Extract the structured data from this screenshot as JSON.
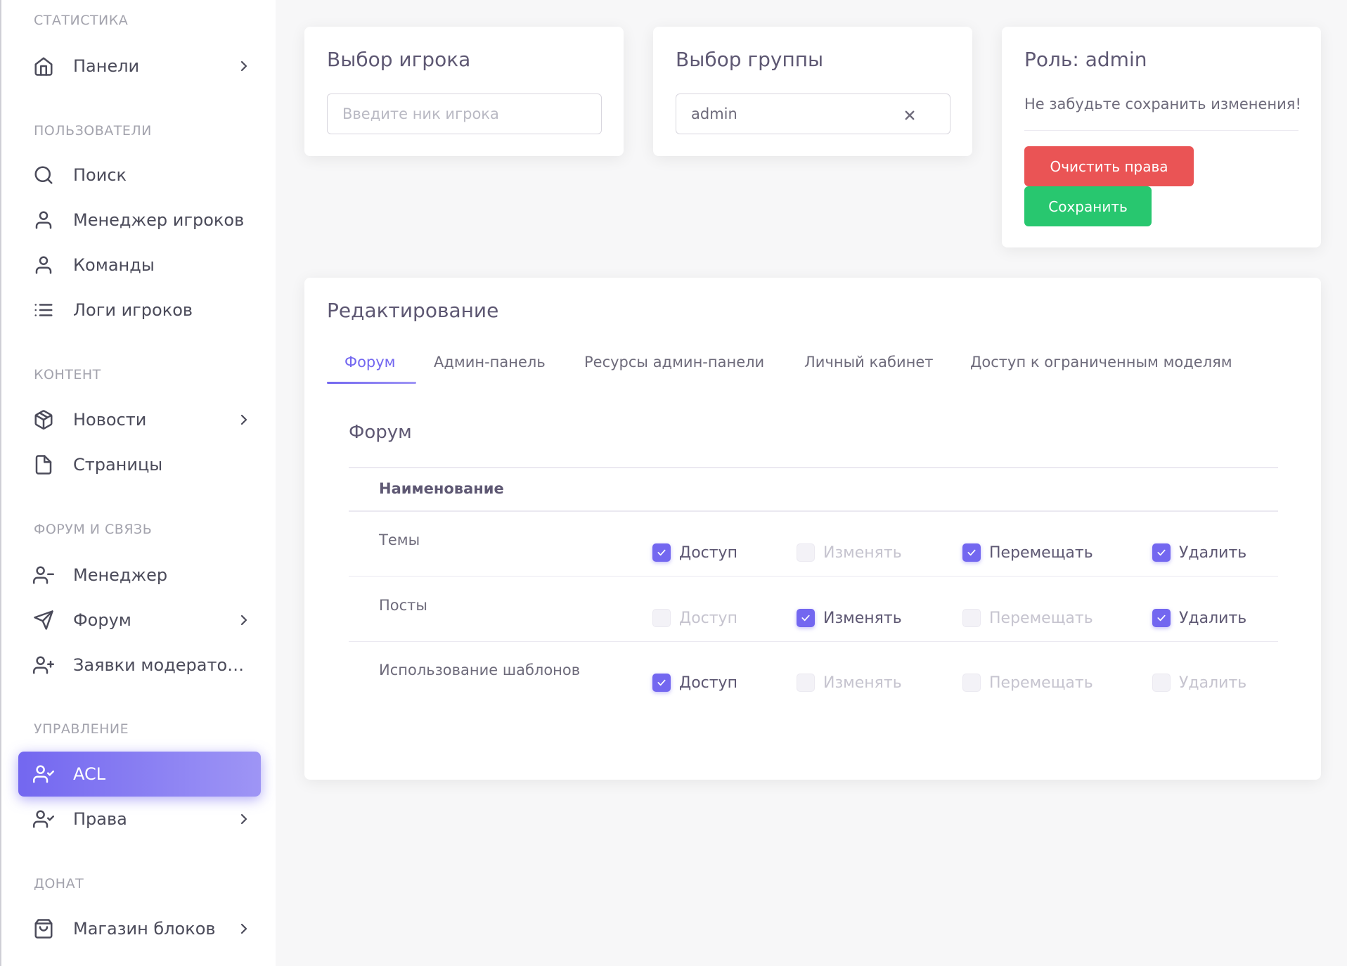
{
  "sidebar": {
    "sections": [
      {
        "header": "СТАТИСТИКА"
      },
      {
        "header": "ПОЛЬЗОВАТЕЛИ"
      },
      {
        "header": "КОНТЕНТ"
      },
      {
        "header": "ФОРУМ И СВЯЗЬ"
      },
      {
        "header": "УПРАВЛЕНИЕ"
      },
      {
        "header": "ДОНАТ"
      }
    ],
    "items": [
      {
        "label": "Панели",
        "icon": "home-icon"
      },
      {
        "label": "Поиск",
        "icon": "search-icon"
      },
      {
        "label": "Менеджер игроков",
        "icon": "user-icon"
      },
      {
        "label": "Команды",
        "icon": "user-icon"
      },
      {
        "label": "Логи игроков",
        "icon": "list-icon"
      },
      {
        "label": "Новости",
        "icon": "package-icon"
      },
      {
        "label": "Страницы",
        "icon": "file-icon"
      },
      {
        "label": "Менеджер",
        "icon": "user-minus-icon"
      },
      {
        "label": "Форум",
        "icon": "send-icon"
      },
      {
        "label": "Заявки модераторов",
        "icon": "user-plus-icon"
      },
      {
        "label": "ACL",
        "icon": "user-check-icon"
      },
      {
        "label": "Права",
        "icon": "user-check-icon"
      },
      {
        "label": "Магазин блоков",
        "icon": "shopping-bag-icon"
      }
    ]
  },
  "player_select": {
    "title": "Выбор игрока",
    "placeholder": "Введите ник игрока"
  },
  "group_select": {
    "title": "Выбор группы",
    "value": "admin"
  },
  "role_card": {
    "title": "Роль: admin",
    "note": "Не забудьте сохранить изменения!",
    "clear_label": "Очистить права",
    "save_label": "Сохранить"
  },
  "editor": {
    "title": "Редактирование",
    "tabs": [
      "Форум",
      "Админ-панель",
      "Ресурсы админ-панели",
      "Личный кабинет",
      "Доступ к ограниченным моделям"
    ],
    "active_tab": "Форум",
    "section_title": "Форум",
    "column_header": "Наименование",
    "rows": [
      {
        "name": "Темы",
        "perms": [
          {
            "label": "Доступ",
            "checked": true
          },
          {
            "label": "Изменять",
            "checked": false
          },
          {
            "label": "Перемещать",
            "checked": true
          },
          {
            "label": "Удалить",
            "checked": true
          }
        ]
      },
      {
        "name": "Посты",
        "perms": [
          {
            "label": "Доступ",
            "checked": false
          },
          {
            "label": "Изменять",
            "checked": true
          },
          {
            "label": "Перемещать",
            "checked": false
          },
          {
            "label": "Удалить",
            "checked": true
          }
        ]
      },
      {
        "name": "Использование шаблонов",
        "perms": [
          {
            "label": "Доступ",
            "checked": true
          },
          {
            "label": "Изменять",
            "checked": false
          },
          {
            "label": "Перемещать",
            "checked": false
          },
          {
            "label": "Удалить",
            "checked": false
          }
        ]
      }
    ]
  },
  "colors": {
    "primary": "#7367f0",
    "danger": "#ea5455",
    "success": "#28c76f"
  }
}
